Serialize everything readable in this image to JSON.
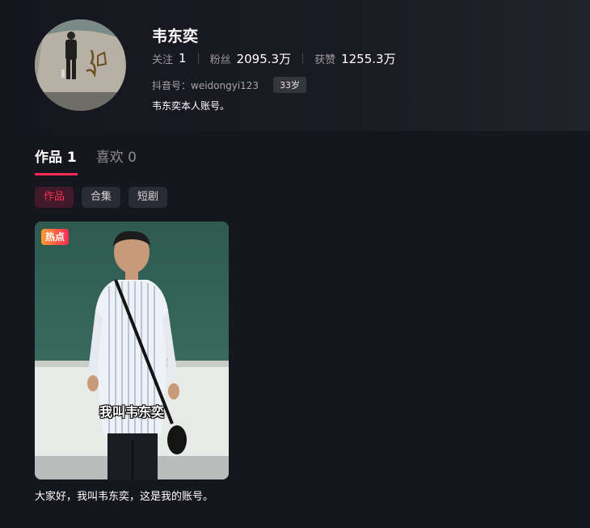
{
  "profile": {
    "name": "韦东奕",
    "following_label": "关注",
    "following_value": "1",
    "followers_label": "粉丝",
    "followers_value": "2095.3万",
    "likes_label": "获赞",
    "likes_value": "1255.3万",
    "douyin_id": "抖音号：weidongyi123",
    "age": "33岁",
    "bio": "韦东奕本人账号。"
  },
  "tabs": [
    {
      "label": "作品 1"
    },
    {
      "label": "喜欢 0"
    }
  ],
  "chips": [
    {
      "label": "作品"
    },
    {
      "label": "合集"
    },
    {
      "label": "短剧"
    }
  ],
  "videos": [
    {
      "badge": "热点",
      "subtitle": "我叫韦东奕",
      "caption": "大家好，我叫韦东奕，这是我的账号。"
    }
  ],
  "colors": {
    "accent": "#fe2c55",
    "background": "#16161f"
  }
}
